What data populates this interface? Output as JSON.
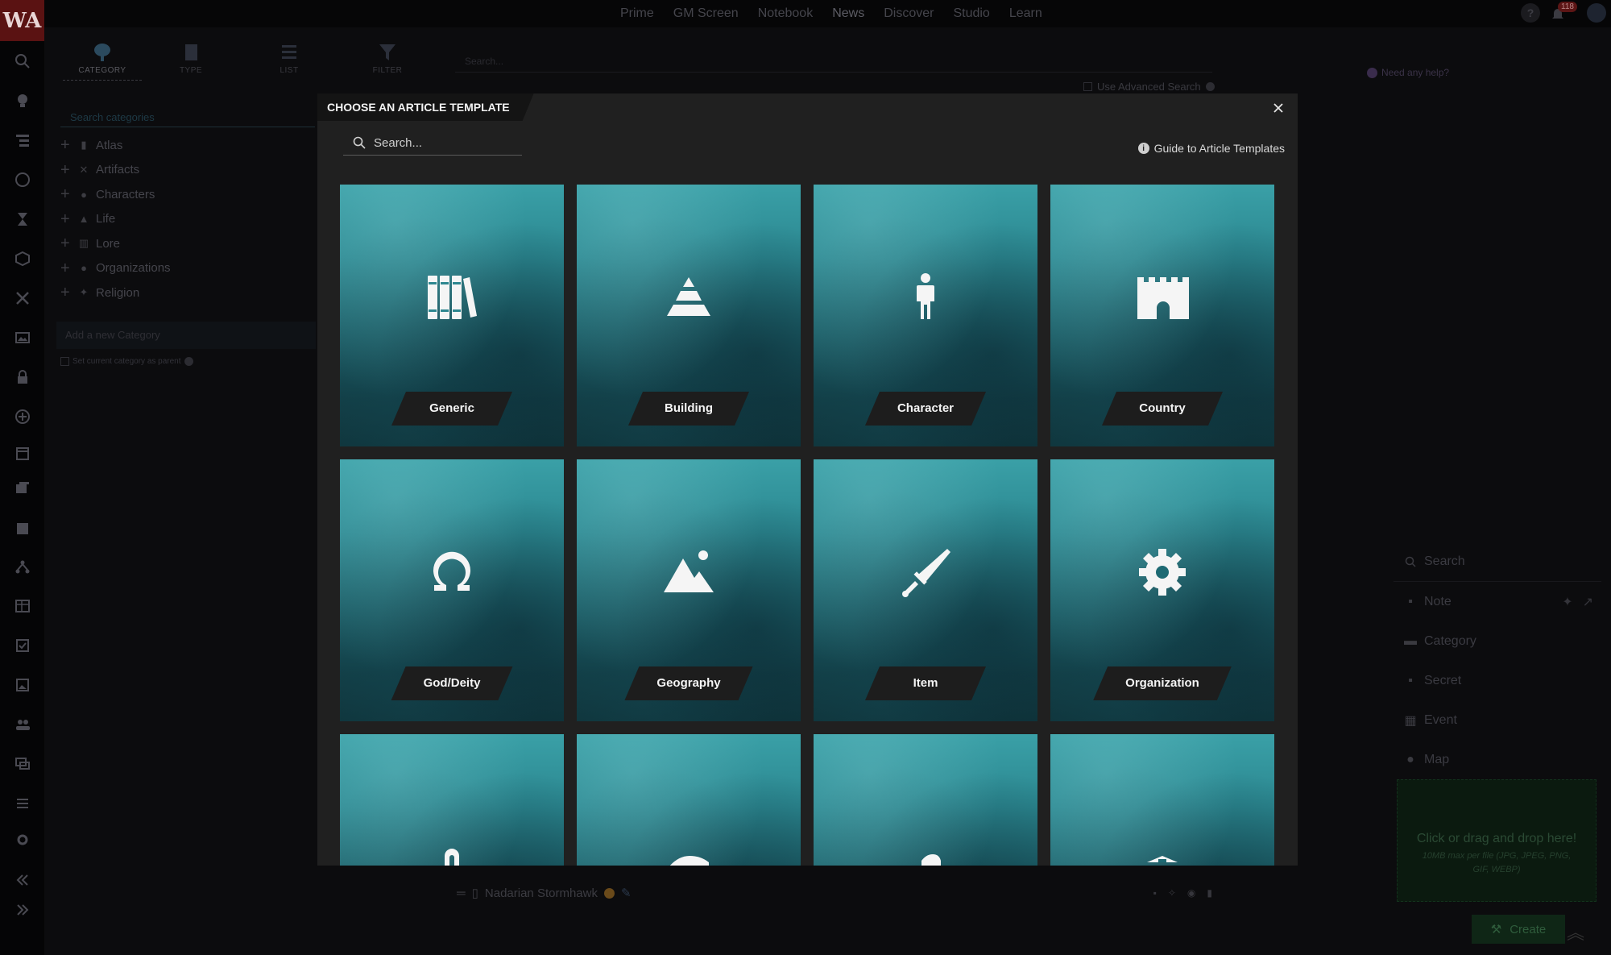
{
  "app": {
    "logo_text": "WA",
    "nav": [
      "Prime",
      "GM Screen",
      "Notebook",
      "News",
      "Discover",
      "Studio",
      "Learn"
    ],
    "notification_count": "118"
  },
  "sidebar": {
    "tabs": [
      {
        "label": "CATEGORY",
        "icon": "tree-icon"
      },
      {
        "label": "TYPE",
        "icon": "book-icon"
      },
      {
        "label": "LIST",
        "icon": "list-icon"
      },
      {
        "label": "FILTER",
        "icon": "filter-icon"
      }
    ],
    "search_placeholder": "Search categories",
    "categories": [
      "Atlas",
      "Artifacts",
      "Characters",
      "Life",
      "Lore",
      "Organizations",
      "Religion"
    ],
    "add_category": "Add a new Category",
    "set_parent": "Set current category as parent"
  },
  "main": {
    "search_placeholder": "Search...",
    "advanced_search": "Use Advanced Search",
    "help_link": "Need any help?"
  },
  "quick_panel": {
    "search": "Search",
    "items": [
      "Note",
      "Category",
      "Secret",
      "Event",
      "Map"
    ],
    "drop_title": "Click or drag and drop here!",
    "drop_sub": "10MB max per file (JPG, JPEG, PNG, GIF, WEBP)",
    "create": "Create"
  },
  "bottom_bar": {
    "article_name": "Nadarian Stormhawk"
  },
  "modal": {
    "title": "CHOOSE AN ARTICLE TEMPLATE",
    "search_placeholder": "Search...",
    "guide_link": "Guide to Article Templates",
    "templates": [
      {
        "label": "Generic",
        "icon": "books-icon"
      },
      {
        "label": "Building",
        "icon": "pyramid-icon"
      },
      {
        "label": "Character",
        "icon": "person-icon"
      },
      {
        "label": "Country",
        "icon": "castle-icon"
      },
      {
        "label": "God/Deity",
        "icon": "omega-icon"
      },
      {
        "label": "Geography",
        "icon": "mountain-icon"
      },
      {
        "label": "Item",
        "icon": "sword-icon"
      },
      {
        "label": "Organization",
        "icon": "gear-icon"
      },
      {
        "label": "",
        "icon": "partial-icon"
      },
      {
        "label": "",
        "icon": "partial-icon"
      },
      {
        "label": "",
        "icon": "partial-icon"
      },
      {
        "label": "",
        "icon": "partial-icon"
      }
    ]
  },
  "colors": {
    "card_top": "#3aa0a7",
    "card_bottom": "#0f343b",
    "modal_bg": "#202020",
    "label_bg": "#1d1d1d",
    "rail_logo": "#5a1212"
  }
}
